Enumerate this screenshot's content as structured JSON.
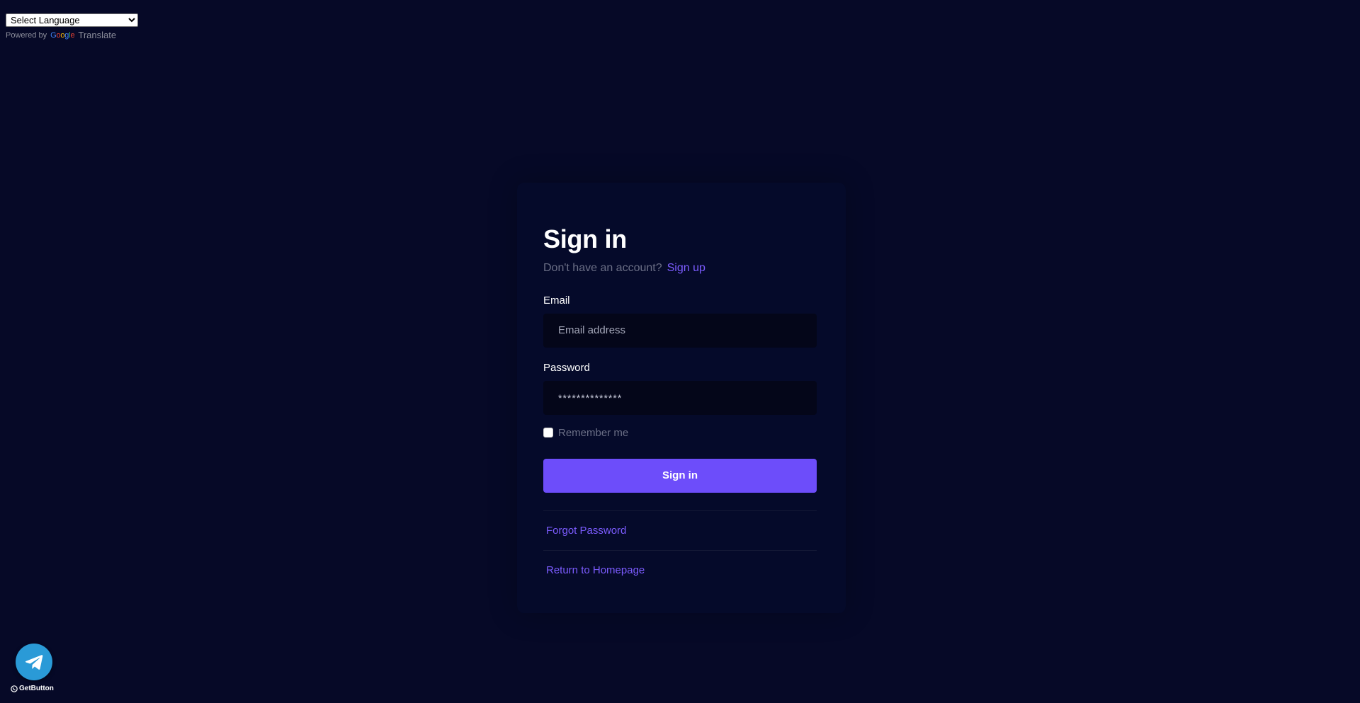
{
  "translate": {
    "select_label": "Select Language",
    "powered_by": "Powered by",
    "google": [
      "G",
      "o",
      "o",
      "g",
      "l",
      "e"
    ],
    "translate_word": "Translate"
  },
  "signin": {
    "title": "Sign in",
    "no_account_text": "Don't have an account?",
    "signup_link": "Sign up",
    "email_label": "Email",
    "email_placeholder": "Email address",
    "password_label": "Password",
    "password_value": "**************",
    "remember_label": "Remember me",
    "submit_label": "Sign in",
    "forgot_link": "Forgot Password",
    "home_link": "Return to Homepage"
  },
  "widget": {
    "icon": "telegram-icon",
    "label": "GetButton"
  },
  "colors": {
    "background": "#060927",
    "card": "#050a2a",
    "accent": "#6d4dfa",
    "link": "#7c5cff",
    "telegram": "#2a9ad7"
  }
}
